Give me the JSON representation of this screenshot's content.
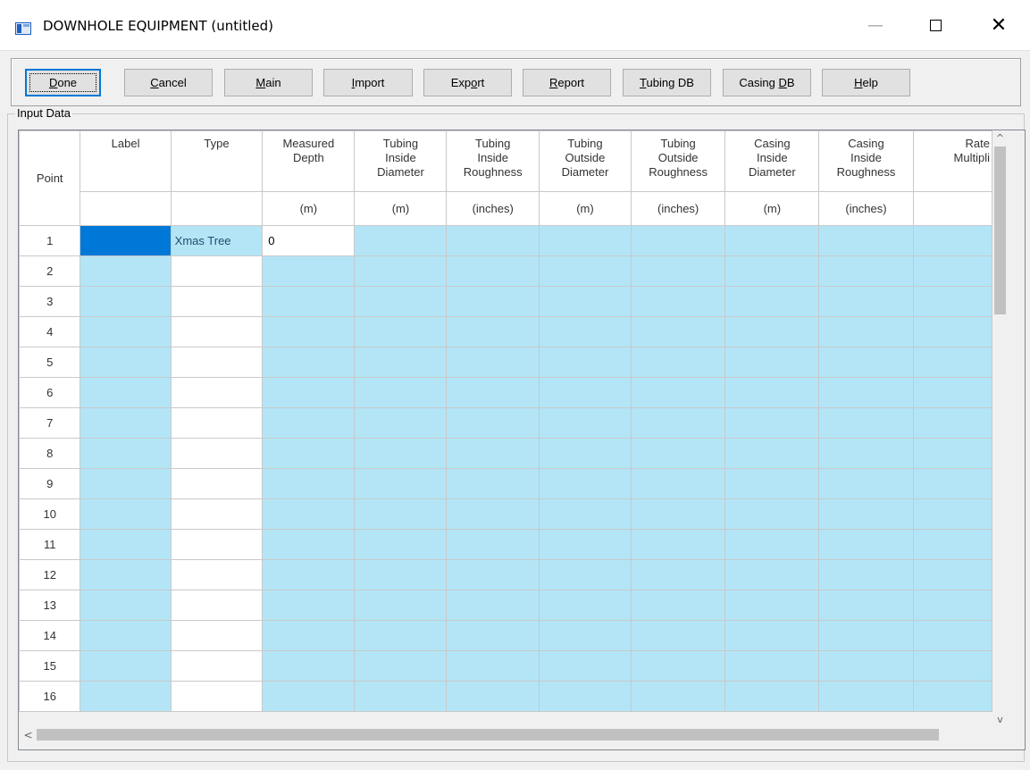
{
  "window": {
    "title": "DOWNHOLE EQUIPMENT (untitled)",
    "minimize_glyph": "—",
    "close_glyph": "✕"
  },
  "toolbar": {
    "buttons": [
      {
        "label": "Done",
        "mnemonic": "D",
        "rest": "one"
      },
      {
        "label": "Cancel",
        "mnemonic": "C",
        "rest": "ancel"
      },
      {
        "label": "Main",
        "mnemonic": "M",
        "rest": "ain"
      },
      {
        "label": "Import",
        "mnemonic": "I",
        "rest": "mport"
      },
      {
        "label": "Export",
        "pre": "Exp",
        "mnemonic": "o",
        "rest": "rt"
      },
      {
        "label": "Report",
        "mnemonic": "R",
        "rest": "eport"
      },
      {
        "label": "Tubing DB",
        "mnemonic": "T",
        "rest": "ubing DB"
      },
      {
        "label": "Casing DB",
        "pre": "Casing ",
        "mnemonic": "D",
        "rest": "B"
      },
      {
        "label": "Help",
        "mnemonic": "H",
        "rest": "elp"
      }
    ]
  },
  "input_data": {
    "group_label": "Input Data",
    "columns": [
      {
        "header": [
          "Point"
        ],
        "unit": ""
      },
      {
        "header": [
          "Label"
        ],
        "unit": ""
      },
      {
        "header": [
          "Type"
        ],
        "unit": ""
      },
      {
        "header": [
          "Measured",
          "Depth"
        ],
        "unit": "(m)"
      },
      {
        "header": [
          "Tubing",
          "Inside",
          "Diameter"
        ],
        "unit": "(m)"
      },
      {
        "header": [
          "Tubing",
          "Inside",
          "Roughness"
        ],
        "unit": "(inches)"
      },
      {
        "header": [
          "Tubing",
          "Outside",
          "Diameter"
        ],
        "unit": "(m)"
      },
      {
        "header": [
          "Tubing",
          "Outside",
          "Roughness"
        ],
        "unit": "(inches)"
      },
      {
        "header": [
          "Casing",
          "Inside",
          "Diameter"
        ],
        "unit": "(m)"
      },
      {
        "header": [
          "Casing",
          "Inside",
          "Roughness"
        ],
        "unit": "(inches)"
      },
      {
        "header": [
          "Rate",
          "Multipli"
        ],
        "unit": ""
      }
    ],
    "rows": [
      {
        "point": "1",
        "type": "Xmas Tree",
        "depth": "0"
      },
      {
        "point": "2",
        "type": "",
        "depth": ""
      },
      {
        "point": "3",
        "type": "",
        "depth": ""
      },
      {
        "point": "4",
        "type": "",
        "depth": ""
      },
      {
        "point": "5",
        "type": "",
        "depth": ""
      },
      {
        "point": "6",
        "type": "",
        "depth": ""
      },
      {
        "point": "7",
        "type": "",
        "depth": ""
      },
      {
        "point": "8",
        "type": "",
        "depth": ""
      },
      {
        "point": "9",
        "type": "",
        "depth": ""
      },
      {
        "point": "10",
        "type": "",
        "depth": ""
      },
      {
        "point": "11",
        "type": "",
        "depth": ""
      },
      {
        "point": "12",
        "type": "",
        "depth": ""
      },
      {
        "point": "13",
        "type": "",
        "depth": ""
      },
      {
        "point": "14",
        "type": "",
        "depth": ""
      },
      {
        "point": "15",
        "type": "",
        "depth": ""
      },
      {
        "point": "16",
        "type": "",
        "depth": ""
      }
    ]
  },
  "scrollbars": {
    "up_glyph": "^",
    "down_glyph": "v",
    "left_glyph": "<",
    "right_glyph": ">"
  }
}
